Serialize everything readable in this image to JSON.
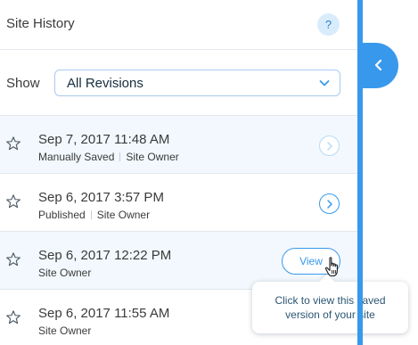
{
  "panel": {
    "title": "Site History",
    "help_label": "?"
  },
  "filter": {
    "label": "Show",
    "selected": "All Revisions"
  },
  "revisions": [
    {
      "date": "Sep 7, 2017 11:48 AM",
      "status": "Manually Saved",
      "author": "Site Owner"
    },
    {
      "date": "Sep 6, 2017 3:57 PM",
      "status": "Published",
      "author": "Site Owner"
    },
    {
      "date": "Sep 6, 2017 12:22 PM",
      "status": "",
      "author": "Site Owner",
      "action_label": "View"
    },
    {
      "date": "Sep 6, 2017 11:55 AM",
      "status": "",
      "author": "Site Owner"
    }
  ],
  "tooltip": {
    "line1": "Click to view this saved",
    "line2": "version of your site"
  },
  "colors": {
    "accent": "#3899ec",
    "row_highlight": "#f2f8fd"
  },
  "icons": {
    "help": "question-icon",
    "star": "star-outline-icon",
    "arrow": "chevron-right-icon",
    "dropdown": "chevron-down-icon",
    "collapse": "chevron-left-icon",
    "cursor": "hand-pointer-icon"
  }
}
